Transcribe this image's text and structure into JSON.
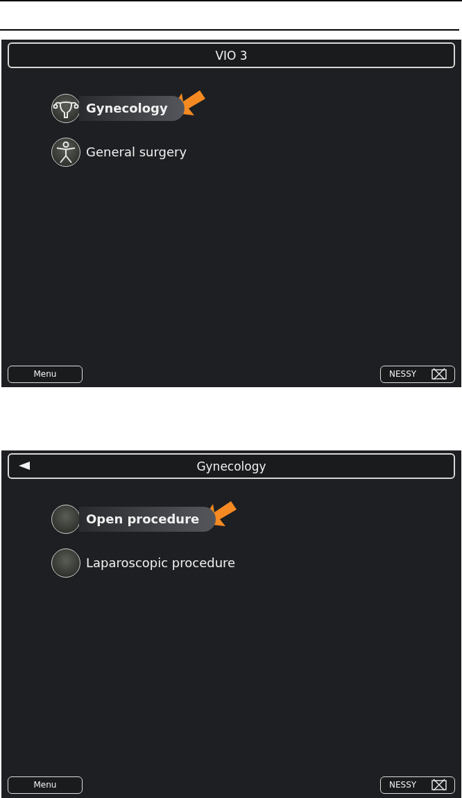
{
  "screens": [
    {
      "title": "VIO 3",
      "back": false,
      "items": [
        {
          "label": "Gynecology",
          "kind": "uterus",
          "selected": true
        },
        {
          "label": "General surgery",
          "kind": "body",
          "selected": false
        }
      ],
      "menu": "Menu",
      "nessy": "NESSY"
    },
    {
      "title": "Gynecology",
      "back": true,
      "items": [
        {
          "label": "Open procedure",
          "kind": "plain",
          "selected": true
        },
        {
          "label": "Laparoscopic procedure",
          "kind": "plain",
          "selected": false
        }
      ],
      "menu": "Menu",
      "nessy": "NESSY"
    }
  ]
}
